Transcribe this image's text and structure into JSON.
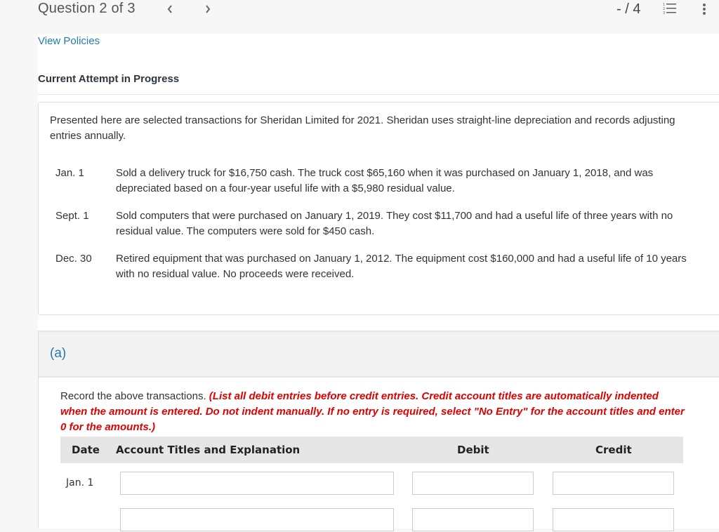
{
  "header": {
    "question_title": "Question 2 of 3",
    "score": "- / 4",
    "icons": {
      "prev": "chevron-left-icon",
      "next": "chevron-right-icon",
      "list": "numbered-list-icon",
      "more": "more-vertical-icon"
    }
  },
  "links": {
    "view_policies": "View Policies"
  },
  "status": {
    "attempt": "Current Attempt in Progress"
  },
  "problem": {
    "intro": "Presented here are selected transactions for Sheridan Limited for 2021. Sheridan uses straight-line depreciation and records adjusting entries annually.",
    "transactions": [
      {
        "date": "Jan. 1",
        "text": "Sold a delivery truck for $16,750 cash. The truck cost $65,160 when it was purchased on January 1, 2018, and was depreciated based on a four-year useful life with a $5,980 residual value."
      },
      {
        "date": "Sept. 1",
        "text": "Sold computers that were purchased on January 1, 2019. They cost $11,700 and had a useful life of three years with no residual value. The computers were sold for $450 cash."
      },
      {
        "date": "Dec. 30",
        "text": "Retired equipment that was purchased on January 1, 2012. The equipment cost $160,000 and had a useful life of 10 years with no residual value. No proceeds were received."
      }
    ]
  },
  "part_a": {
    "label": "(a)",
    "instruction_plain": "Record the above transactions. ",
    "instruction_red": "(List all debit entries before credit entries. Credit account titles are automatically indented when the amount is entered. Do not indent manually. If no entry is required, select \"No Entry\" for the account titles and enter 0 for the amounts.)",
    "table": {
      "headers": {
        "date": "Date",
        "account": "Account Titles and Explanation",
        "debit": "Debit",
        "credit": "Credit"
      },
      "rows": [
        {
          "date": "Jan. 1",
          "account": "",
          "debit": "",
          "credit": ""
        },
        {
          "date": "",
          "account": "",
          "debit": "",
          "credit": ""
        }
      ]
    }
  }
}
